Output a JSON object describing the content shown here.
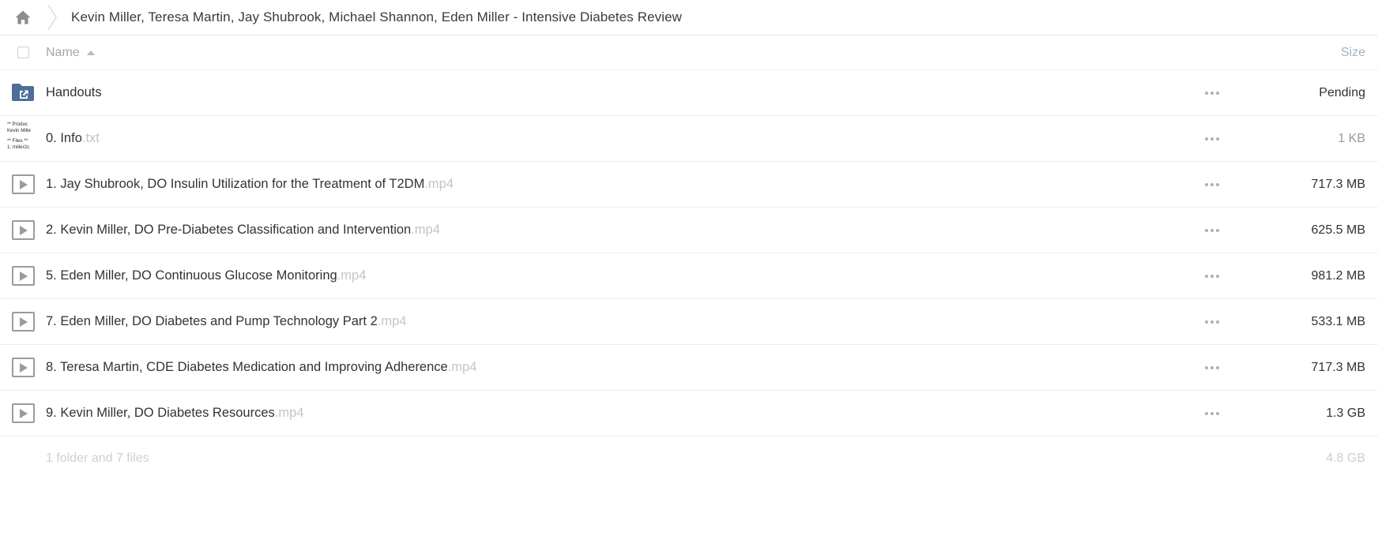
{
  "breadcrumb": {
    "home_icon": "home-icon",
    "separator_icon": "chevron-right-icon",
    "title": "Kevin Miller, Teresa Martin, Jay Shubrook, Michael Shannon, Eden Miller - Intensive Diabetes Review"
  },
  "table": {
    "headers": {
      "name": "Name",
      "size": "Size",
      "sort_direction": "ascending"
    },
    "rows": [
      {
        "icon": "shared-folder-icon",
        "name": "Handouts",
        "ext": "",
        "size": "Pending",
        "size_style": "dark",
        "menu": "more-options-icon"
      },
      {
        "icon": "text-file-thumbnail",
        "thumbnail_lines": [
          "** Produc",
          "Kevin Mille",
          "",
          "** Files **",
          "1: miller2c"
        ],
        "name": "0. Info",
        "ext": ".txt",
        "size": "1 KB",
        "size_style": "gray",
        "menu": "more-options-icon"
      },
      {
        "icon": "video-play-icon",
        "name": "1. Jay Shubrook, DO Insulin Utilization for the Treatment of T2DM",
        "ext": ".mp4",
        "size": "717.3 MB",
        "size_style": "dark",
        "menu": "more-options-icon"
      },
      {
        "icon": "video-play-icon",
        "name": "2. Kevin Miller, DO Pre-Diabetes Classification and Intervention",
        "ext": ".mp4",
        "size": "625.5 MB",
        "size_style": "dark",
        "menu": "more-options-icon"
      },
      {
        "icon": "video-play-icon",
        "name": "5. Eden Miller, DO Continuous Glucose Monitoring",
        "ext": ".mp4",
        "size": "981.2 MB",
        "size_style": "dark",
        "menu": "more-options-icon"
      },
      {
        "icon": "video-play-icon",
        "name": "7. Eden Miller, DO Diabetes and Pump Technology Part 2",
        "ext": ".mp4",
        "size": "533.1 MB",
        "size_style": "dark",
        "menu": "more-options-icon"
      },
      {
        "icon": "video-play-icon",
        "name": "8. Teresa Martin, CDE Diabetes Medication and Improving Adherence",
        "ext": ".mp4",
        "size": "717.3 MB",
        "size_style": "dark",
        "menu": "more-options-icon"
      },
      {
        "icon": "video-play-icon",
        "name": "9. Kevin Miller, DO Diabetes Resources",
        "ext": ".mp4",
        "size": "1.3 GB",
        "size_style": "dark",
        "menu": "more-options-icon"
      }
    ]
  },
  "footer": {
    "count_label": "1 folder and 7 files",
    "total_size": "4.8 GB"
  },
  "colors": {
    "folder_blue": "#4e6e99",
    "text_dark": "#2f3337",
    "text_muted": "#9a9a9a",
    "extension_gray": "#c4c4c4",
    "divider": "#ededed"
  }
}
